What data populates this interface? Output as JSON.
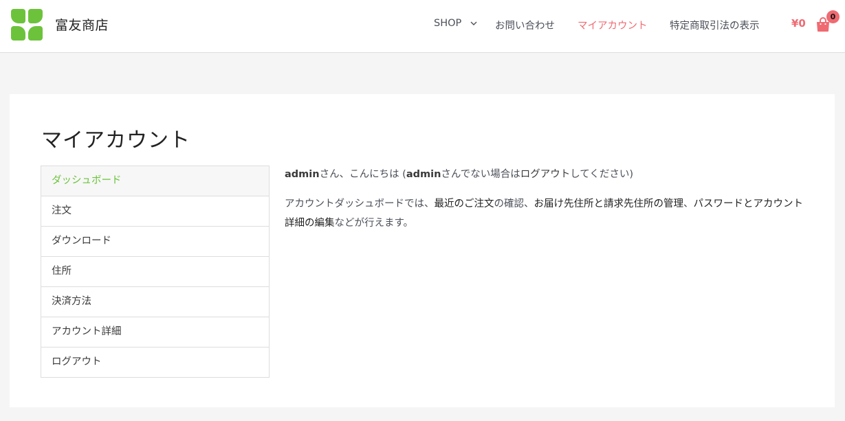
{
  "header": {
    "site_title": "富友商店",
    "nav": {
      "shop": "SHOP",
      "contact": "お問い合わせ",
      "account": "マイアカウント",
      "legal": "特定商取引法の表示"
    },
    "cart_total": "¥0",
    "cart_count": "0",
    "accent_color": "#f06a72",
    "brand_color": "#6cc33b"
  },
  "main": {
    "title": "マイアカウント",
    "account_nav": [
      "ダッシュボード",
      "注文",
      "ダウンロード",
      "住所",
      "決済方法",
      "アカウント詳細",
      "ログアウト"
    ],
    "greeting": {
      "name1": "admin",
      "part1": "さん、こんにちは (",
      "name2": "admin",
      "part2": "さんでない場合は",
      "logout_link": "ログアウト",
      "part3": "してください)"
    },
    "description": {
      "part1": "アカウントダッシュボードでは、",
      "link_orders": "最近のご注文",
      "part2": "の確認、",
      "link_addresses": "お届け先住所と請求先住所の管理",
      "part3": "、",
      "link_account": "パスワードとアカウント詳細の編集",
      "part4": "などが行えます。"
    }
  }
}
